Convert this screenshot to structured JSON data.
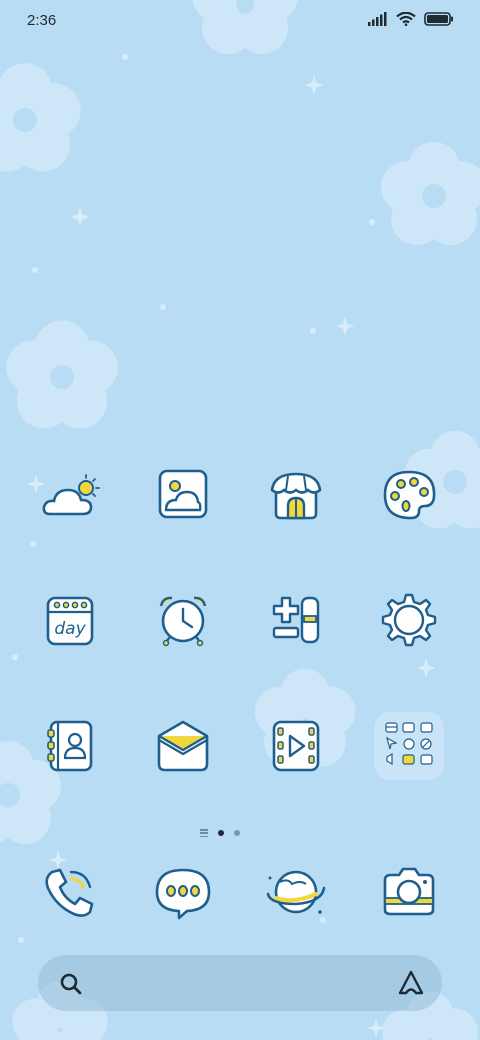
{
  "status_bar": {
    "time": "2:36",
    "icons": [
      "signal-icon",
      "wifi-icon",
      "battery-icon"
    ]
  },
  "home_grid": {
    "rows": [
      [
        {
          "name": "weather",
          "icon": "cloud-sun-icon"
        },
        {
          "name": "gallery",
          "icon": "picture-icon"
        },
        {
          "name": "themes",
          "icon": "shop-icon"
        },
        {
          "name": "palette",
          "icon": "palette-icon"
        }
      ],
      [
        {
          "name": "calendar",
          "icon": "calendar-icon",
          "text": "day"
        },
        {
          "name": "clock",
          "icon": "alarm-clock-icon"
        },
        {
          "name": "calculator",
          "icon": "calculator-icon"
        },
        {
          "name": "settings",
          "icon": "gear-icon"
        }
      ],
      [
        {
          "name": "contacts",
          "icon": "contacts-icon"
        },
        {
          "name": "mail",
          "icon": "envelope-icon"
        },
        {
          "name": "video",
          "icon": "film-play-icon"
        },
        {
          "name": "folder",
          "icon": "app-folder-icon"
        }
      ]
    ]
  },
  "page_indicator": {
    "pages": 2,
    "active": 0
  },
  "dock": [
    {
      "name": "phone",
      "icon": "phone-icon"
    },
    {
      "name": "messages",
      "icon": "chat-bubble-icon"
    },
    {
      "name": "browser",
      "icon": "planet-icon"
    },
    {
      "name": "camera",
      "icon": "camera-icon"
    }
  ],
  "search_bar": {
    "icons": [
      "search-icon",
      "assistant-icon"
    ]
  },
  "colors": {
    "background": "#b8dcf3",
    "flower": "#d6ebfa",
    "outline": "#1f5f8e",
    "accent_yellow": "#f2d73c"
  }
}
